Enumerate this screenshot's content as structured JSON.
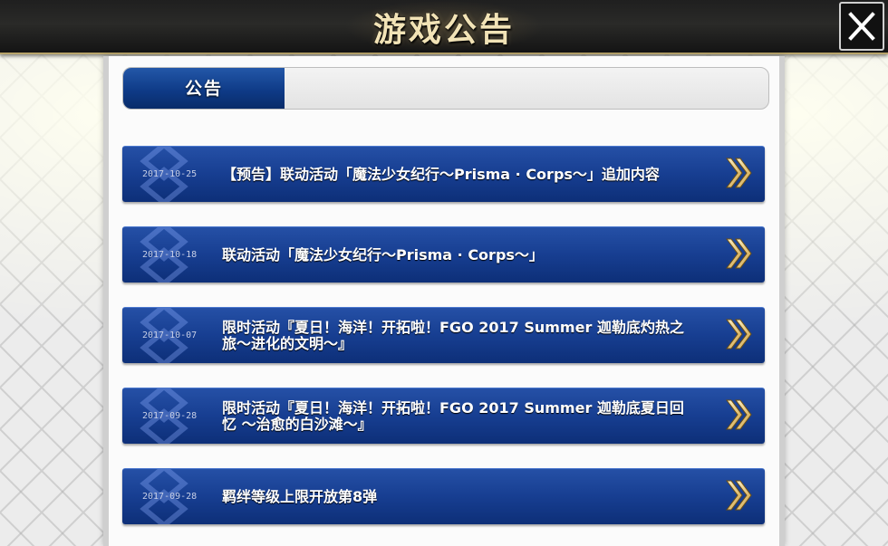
{
  "header": {
    "title": "游戏公告",
    "close_icon": "close-icon"
  },
  "tabs": [
    {
      "label": "公告",
      "active": true
    }
  ],
  "news": [
    {
      "date": "2017-10-25",
      "title": "【预告】联动活动「魔法少女纪行～Prisma · Corps～」追加内容"
    },
    {
      "date": "2017-10-18",
      "title": "联动活动「魔法少女纪行～Prisma · Corps～」"
    },
    {
      "date": "2017-10-07",
      "title": "限时活动『夏日！海洋！开拓啦！FGO 2017 Summer 迦勒底灼热之旅～进化的文明～』"
    },
    {
      "date": "2017-09-28",
      "title": "限时活动『夏日！海洋！开拓啦！FGO 2017 Summer 迦勒底夏日回忆 ～治愈的白沙滩～』"
    },
    {
      "date": "2017-09-28",
      "title": "羁绊等级上限开放第8弹"
    }
  ],
  "colors": {
    "accent_blue": "#173e91",
    "title_gold": "#f2e3b6",
    "arrow_gold": "#e8c870"
  },
  "icons": {
    "arrow": "double-chevron-right-icon",
    "emblem": "fgo-emblem-icon"
  }
}
